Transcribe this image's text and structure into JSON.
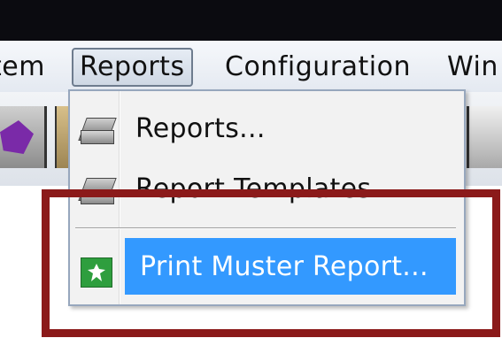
{
  "menubar": {
    "items": [
      {
        "label": "tem"
      },
      {
        "label": "Reports"
      },
      {
        "label": "Configuration"
      },
      {
        "label": "Win"
      }
    ]
  },
  "reports_menu": {
    "items": [
      {
        "label": "Reports...",
        "icon": "report-icon"
      },
      {
        "label": "Report Templates...",
        "icon": "report-template-icon"
      },
      {
        "label": "Print Muster Report...",
        "icon": "muster-report-icon",
        "highlighted": true
      }
    ]
  },
  "colors": {
    "highlight": "#3399ff",
    "annotation_frame": "#8b1a1a",
    "title_strip": "#0b0b10"
  }
}
